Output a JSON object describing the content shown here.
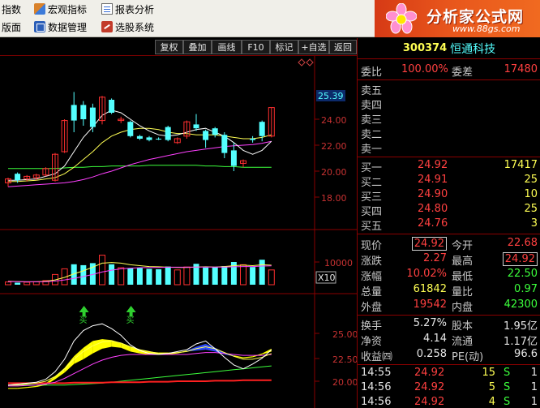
{
  "menubar": {
    "items": [
      {
        "label": "指数",
        "icon": "none"
      },
      {
        "label": "宏观指标",
        "icon": "macro-icon"
      },
      {
        "label": "报表分析",
        "icon": "report-icon"
      },
      {
        "label": "版面",
        "icon": "none"
      },
      {
        "label": "数据管理",
        "icon": "data-icon"
      },
      {
        "label": "选股系统",
        "icon": "pick-icon"
      }
    ]
  },
  "logo": {
    "title": "分析家公式网",
    "url": "www.88gs.com"
  },
  "toolbar": {
    "buttons": [
      "复权",
      "叠加",
      "画线",
      "F10",
      "标记",
      "+自选",
      "返回"
    ]
  },
  "price_axis": {
    "highlight": "25.39",
    "ticks": [
      "24.00",
      "22.00",
      "20.00",
      "18.00"
    ]
  },
  "volume_axis": {
    "tick": "10000",
    "multiplier": "X10"
  },
  "indicator_axis": {
    "ticks": [
      "25.00",
      "22.50",
      "20.00"
    ],
    "signal_glyph": "买"
  },
  "colors": {
    "up": "#ff3030",
    "down": "#54ffff",
    "ma5": "#ffffff",
    "ma10": "#ffff54",
    "ma20": "#ff40ff",
    "ma60": "#3cff3c",
    "frame": "#8a0000"
  },
  "chart_data": {
    "type": "candlestick",
    "candles": [
      {
        "o": 19.1,
        "h": 19.5,
        "l": 18.8,
        "c": 19.4,
        "up": true
      },
      {
        "o": 19.8,
        "h": 19.9,
        "l": 19.1,
        "c": 19.3,
        "up": false
      },
      {
        "o": 19.4,
        "h": 19.7,
        "l": 19.2,
        "c": 19.6,
        "up": true
      },
      {
        "o": 19.5,
        "h": 19.8,
        "l": 19.3,
        "c": 19.7,
        "up": true
      },
      {
        "o": 19.7,
        "h": 20.3,
        "l": 19.6,
        "c": 20.2,
        "up": true
      },
      {
        "o": 19.3,
        "h": 21.4,
        "l": 19.2,
        "c": 21.3,
        "up": true
      },
      {
        "o": 21.5,
        "h": 24.0,
        "l": 21.4,
        "c": 23.9,
        "up": true
      },
      {
        "o": 23.9,
        "h": 26.1,
        "l": 23.0,
        "c": 25.1,
        "up": false
      },
      {
        "o": 25.1,
        "h": 25.4,
        "l": 23.5,
        "c": 24.0,
        "up": false
      },
      {
        "o": 23.4,
        "h": 25.2,
        "l": 23.0,
        "c": 24.9,
        "up": false
      },
      {
        "o": 23.9,
        "h": 25.8,
        "l": 23.6,
        "c": 25.7,
        "up": true
      },
      {
        "o": 25.5,
        "h": 25.6,
        "l": 24.4,
        "c": 24.5,
        "up": false
      },
      {
        "o": 23.9,
        "h": 24.2,
        "l": 23.7,
        "c": 24.0,
        "up": true
      },
      {
        "o": 23.8,
        "h": 23.9,
        "l": 22.6,
        "c": 22.7,
        "up": false
      },
      {
        "o": 22.7,
        "h": 22.8,
        "l": 22.4,
        "c": 22.5,
        "up": false
      },
      {
        "o": 22.6,
        "h": 22.7,
        "l": 22.3,
        "c": 22.4,
        "up": false
      },
      {
        "o": 22.5,
        "h": 22.6,
        "l": 22.4,
        "c": 22.5,
        "up": false
      },
      {
        "o": 22.4,
        "h": 23.5,
        "l": 22.3,
        "c": 23.4,
        "up": false
      },
      {
        "o": 22.5,
        "h": 22.6,
        "l": 22.1,
        "c": 22.2,
        "up": true
      },
      {
        "o": 22.7,
        "h": 23.9,
        "l": 22.5,
        "c": 23.8,
        "up": true
      },
      {
        "o": 23.3,
        "h": 24.4,
        "l": 23.1,
        "c": 23.6,
        "up": false
      },
      {
        "o": 22.4,
        "h": 23.2,
        "l": 21.8,
        "c": 23.1,
        "up": false
      },
      {
        "o": 22.8,
        "h": 23.4,
        "l": 22.6,
        "c": 23.3,
        "up": false
      },
      {
        "o": 22.8,
        "h": 23.0,
        "l": 21.0,
        "c": 21.4,
        "up": false
      },
      {
        "o": 21.6,
        "h": 22.2,
        "l": 20.0,
        "c": 20.4,
        "up": false
      },
      {
        "o": 20.6,
        "h": 20.9,
        "l": 20.3,
        "c": 20.8,
        "up": true
      },
      {
        "o": 22.4,
        "h": 22.7,
        "l": 22.2,
        "c": 22.5,
        "up": false
      },
      {
        "o": 23.8,
        "h": 23.9,
        "l": 22.3,
        "c": 22.7,
        "up": false
      },
      {
        "o": 22.7,
        "h": 24.9,
        "l": 22.6,
        "c": 24.9,
        "up": true
      }
    ],
    "ma5": [
      19.3,
      19.3,
      19.35,
      19.4,
      19.6,
      19.8,
      20.4,
      21.5,
      22.6,
      23.4,
      24.3,
      24.7,
      24.5,
      24.0,
      23.5,
      23.1,
      22.8,
      22.7,
      22.8,
      23.0,
      23.2,
      23.3,
      23.0,
      22.7,
      22.2,
      21.6,
      21.3,
      21.6,
      22.3
    ],
    "ma10": [
      19.2,
      19.2,
      19.25,
      19.3,
      19.4,
      19.5,
      19.8,
      20.3,
      20.9,
      21.5,
      22.2,
      22.7,
      23.0,
      23.2,
      23.3,
      23.3,
      23.2,
      23.0,
      22.9,
      22.9,
      22.8,
      22.8,
      22.8,
      22.7,
      22.6,
      22.5,
      22.5,
      22.6,
      22.8
    ],
    "ma20": [
      18.8,
      18.85,
      18.9,
      18.95,
      19.0,
      19.05,
      19.1,
      19.2,
      19.35,
      19.55,
      19.8,
      20.0,
      20.25,
      20.5,
      20.7,
      20.9,
      21.05,
      21.2,
      21.35,
      21.5,
      21.6,
      21.7,
      21.8,
      21.9,
      21.95,
      22.0,
      22.05,
      22.15,
      22.3
    ],
    "ma60": [
      20.2,
      20.2,
      20.2,
      20.2,
      20.2,
      20.2,
      20.25,
      20.3,
      20.3,
      20.35,
      20.35,
      20.4,
      20.4,
      20.4,
      20.4,
      20.45,
      20.45,
      20.45,
      20.45,
      20.45,
      20.45,
      20.4,
      20.4,
      20.35,
      20.35,
      20.3,
      20.3,
      20.3,
      20.3
    ],
    "volume": [
      1200,
      900,
      1100,
      1300,
      1800,
      4500,
      7000,
      9000,
      8600,
      9500,
      13000,
      9000,
      7500,
      7200,
      7400,
      7000,
      6800,
      8000,
      6500,
      7800,
      9200,
      7600,
      7800,
      8200,
      10000,
      8800,
      7800,
      11000,
      6500
    ],
    "volume_ma": [
      1500,
      1400,
      1300,
      1300,
      1500,
      2100,
      3200,
      4800,
      6100,
      7700,
      9500,
      9800,
      9500,
      8800,
      8400,
      8000,
      7900,
      7700,
      7600,
      7600,
      7800,
      7900,
      7800,
      8000,
      8400,
      8600,
      8400,
      8800,
      8600
    ],
    "volume_ma2": [
      1400,
      1350,
      1300,
      1300,
      1350,
      1600,
      2100,
      2800,
      3600,
      4500,
      5600,
      6400,
      7000,
      7300,
      7500,
      7600,
      7600,
      7700,
      7700,
      7700,
      7800,
      7800,
      7800,
      7800,
      7900,
      8000,
      8000,
      8200,
      8300
    ],
    "indicator": {
      "white": [
        19.6,
        19.7,
        19.8,
        19.9,
        20.2,
        21.0,
        22.3,
        24.2,
        25.3,
        25.8,
        26.0,
        25.5,
        24.8,
        23.8,
        23.2,
        22.9,
        22.8,
        22.9,
        23.1,
        23.3,
        23.9,
        24.2,
        23.4,
        22.5,
        21.7,
        21.3,
        21.8,
        22.4,
        23.3
      ],
      "yellow": [
        19.6,
        19.6,
        19.7,
        19.8,
        20.0,
        20.5,
        21.3,
        22.3,
        23.1,
        23.7,
        24.1,
        24.2,
        24.0,
        23.6,
        23.3,
        23.1,
        22.9,
        22.9,
        23.0,
        23.1,
        23.4,
        23.6,
        23.4,
        23.0,
        22.6,
        22.3,
        22.3,
        22.5,
        22.9
      ],
      "magenta": [
        19.5,
        19.5,
        19.55,
        19.6,
        19.7,
        19.9,
        20.3,
        20.8,
        21.3,
        21.8,
        22.2,
        22.5,
        22.7,
        22.8,
        22.8,
        22.8,
        22.8,
        22.8,
        22.8,
        22.8,
        22.9,
        23.0,
        23.0,
        22.9,
        22.8,
        22.7,
        22.7,
        22.7,
        22.8
      ],
      "red": [
        19.8,
        19.8,
        19.8,
        19.8,
        19.8,
        19.8,
        19.8,
        19.85,
        19.85,
        19.85,
        19.85,
        19.9,
        19.9,
        19.9,
        19.9,
        19.95,
        19.95,
        19.95,
        20.0,
        20.0,
        20.0,
        20.0,
        20.05,
        20.05,
        20.05,
        20.1,
        20.1,
        20.1,
        20.1
      ],
      "green": [
        19.6,
        19.6,
        19.6,
        19.6,
        19.6,
        19.6,
        19.6,
        19.65,
        19.7,
        19.75,
        19.8,
        19.9,
        20.0,
        20.1,
        20.2,
        20.3,
        20.4,
        20.5,
        20.6,
        20.7,
        20.8,
        20.9,
        21.0,
        21.1,
        21.2,
        21.3,
        21.4,
        21.5,
        21.6
      ],
      "band_low": [
        19.2,
        19.2,
        19.3,
        19.4,
        19.6,
        20.2,
        20.9,
        21.8,
        22.3,
        22.9,
        23.4,
        23.6,
        23.5,
        23.1,
        22.9,
        22.8,
        22.8,
        22.8,
        22.9,
        23.1,
        23.2,
        23.3,
        23.1,
        22.8,
        22.6,
        22.4,
        22.5,
        22.8,
        23.1
      ],
      "band_high": [
        19.3,
        19.3,
        19.4,
        19.5,
        19.8,
        20.5,
        21.4,
        22.6,
        23.5,
        24.2,
        24.4,
        24.3,
        24.0,
        23.6,
        23.3,
        23.1,
        23.0,
        23.0,
        23.0,
        23.2,
        23.6,
        23.9,
        23.5,
        23.0,
        22.7,
        22.5,
        22.6,
        22.9,
        23.4
      ],
      "band_blue_from": 19,
      "band_blue_to": 24,
      "signals": [
        6,
        11
      ]
    }
  },
  "quote": {
    "code": "300374",
    "name": "恒通科技",
    "order": {
      "label1": "委比",
      "value1": "100.00%",
      "label2": "委差",
      "value2": "17480"
    },
    "sell": [
      {
        "label": "卖五"
      },
      {
        "label": "卖四"
      },
      {
        "label": "卖三"
      },
      {
        "label": "卖二"
      },
      {
        "label": "卖一"
      }
    ],
    "buy": [
      {
        "label": "买一",
        "price": "24.92",
        "vol": "17417"
      },
      {
        "label": "买二",
        "price": "24.91",
        "vol": "25"
      },
      {
        "label": "买三",
        "price": "24.90",
        "vol": "10"
      },
      {
        "label": "买四",
        "price": "24.80",
        "vol": "25"
      },
      {
        "label": "买五",
        "price": "24.76",
        "vol": "3"
      }
    ],
    "stats": [
      {
        "l1": "现价",
        "v1": "24.92",
        "l2": "今开",
        "v2": "22.68"
      },
      {
        "l1": "涨跌",
        "v1": "2.27",
        "l2": "最高",
        "v2": "24.92"
      },
      {
        "l1": "涨幅",
        "v1": "10.02%",
        "l2": "最低",
        "v2": "22.50"
      },
      {
        "l1": "总量",
        "v1": "61842",
        "l2": "量比",
        "v2": "0.97"
      },
      {
        "l1": "外盘",
        "v1": "19542",
        "l2": "内盘",
        "v2": "42300"
      }
    ],
    "info": [
      {
        "l1": "换手",
        "v1": "5.27%",
        "l2": "股本",
        "v2": "1.95亿"
      },
      {
        "l1": "净资",
        "v1": "4.14",
        "l2": "流通",
        "v2": "1.17亿"
      },
      {
        "l1": "收益㈣",
        "v1": "0.258",
        "l2": "PE(动)",
        "v2": "96.6"
      }
    ],
    "ticks": [
      {
        "time": "14:55",
        "price": "24.92",
        "vol": "15",
        "side": "S",
        "num": "1"
      },
      {
        "time": "14:56",
        "price": "24.92",
        "vol": "5",
        "side": "S",
        "num": "1"
      },
      {
        "time": "14:56",
        "price": "24.92",
        "vol": "4",
        "side": "S",
        "num": "1"
      }
    ]
  }
}
